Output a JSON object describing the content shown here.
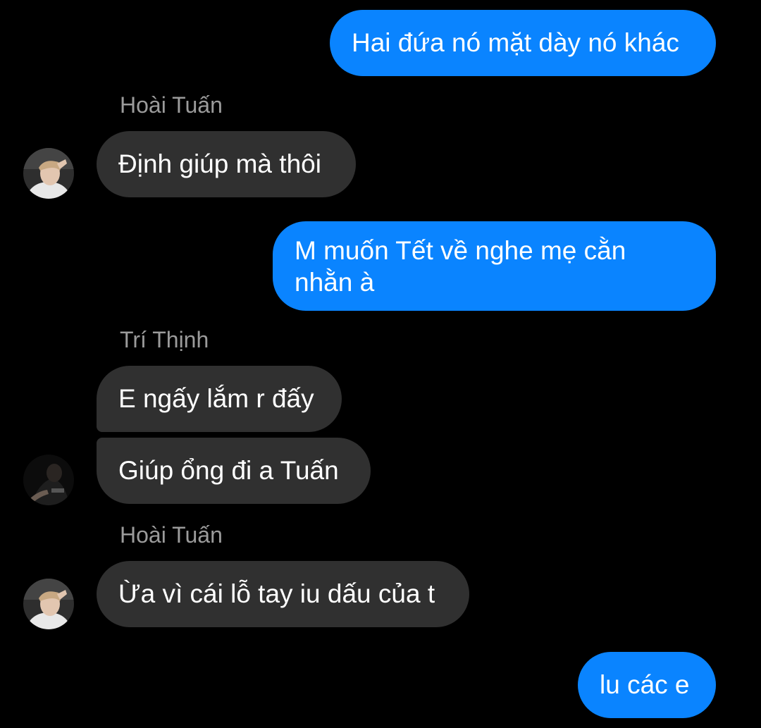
{
  "colors": {
    "background": "#000000",
    "outgoing_bubble": "#0a84ff",
    "incoming_bubble": "#303030",
    "sender_name": "#9b9b9b",
    "text": "#ffffff"
  },
  "messages": [
    {
      "direction": "outgoing",
      "text": "Hai đứa nó mặt dày nó khác"
    },
    {
      "direction": "sender-label",
      "text": "Hoài Tuấn"
    },
    {
      "direction": "incoming",
      "sender": "Hoài Tuấn",
      "text": "Định giúp mà thôi",
      "avatar": "avatar-hoai-tuan"
    },
    {
      "direction": "outgoing",
      "text": "M muốn Tết về nghe mẹ cằn\nnhằn à"
    },
    {
      "direction": "sender-label",
      "text": "Trí Thịnh"
    },
    {
      "direction": "incoming",
      "sender": "Trí Thịnh",
      "text": "E ngấy lắm r đấy"
    },
    {
      "direction": "incoming",
      "sender": "Trí Thịnh",
      "text": "Giúp ổng đi a Tuấn",
      "avatar": "avatar-tri-thinh"
    },
    {
      "direction": "sender-label",
      "text": "Hoài Tuấn"
    },
    {
      "direction": "incoming",
      "sender": "Hoài Tuấn",
      "text": "Ừa vì cái lỗ tay iu dấu của t",
      "avatar": "avatar-hoai-tuan"
    },
    {
      "direction": "outgoing",
      "text": "lu các e"
    }
  ],
  "labels": {
    "m0": "Hai đứa nó mặt dày nó khác",
    "s1": "Hoài Tuấn",
    "m2": "Định giúp mà thôi",
    "m3_line1": "M muốn Tết về nghe mẹ cằn",
    "m3_line2": "nhằn à",
    "s4": "Trí Thịnh",
    "m5": "E ngấy lắm r đấy",
    "m6": "Giúp ổng đi a Tuấn",
    "s7": "Hoài Tuấn",
    "m8": "Ừa vì cái lỗ tay iu dấu của t",
    "m9": "lu các e"
  }
}
